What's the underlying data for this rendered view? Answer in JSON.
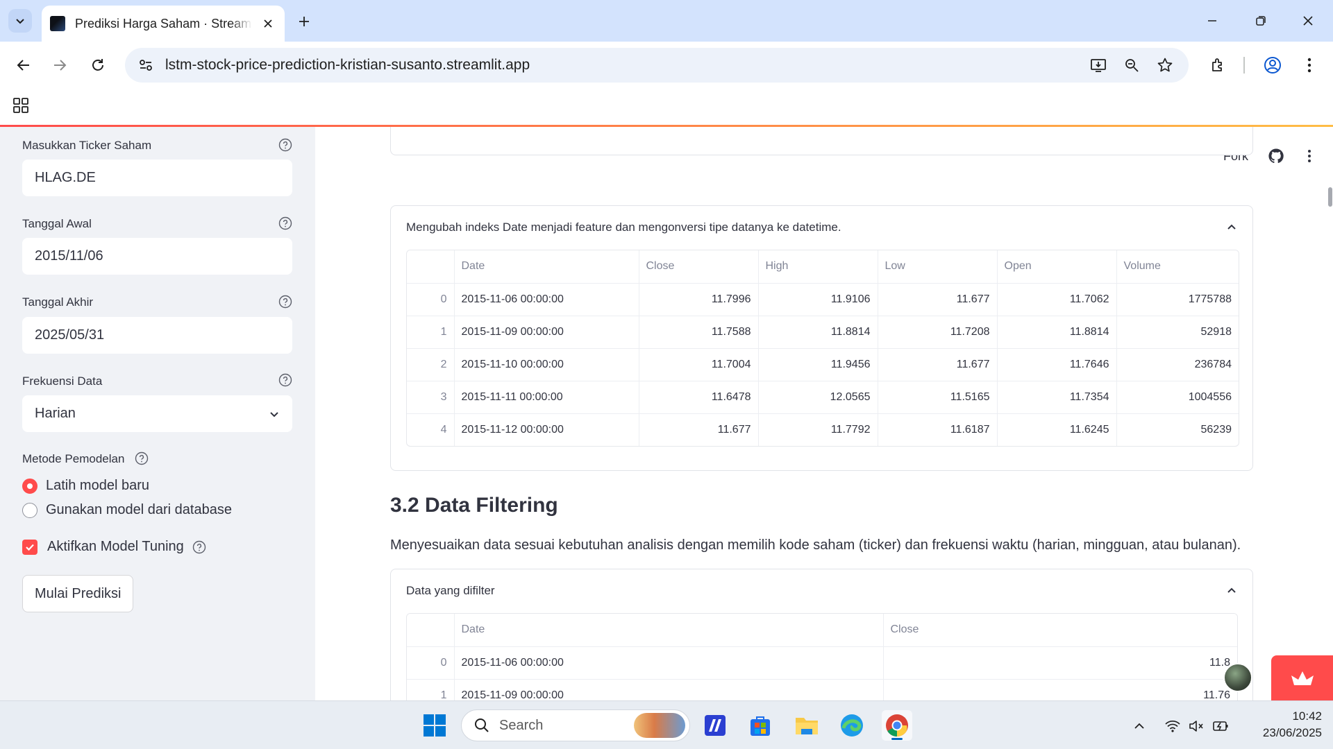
{
  "browser": {
    "tab_title": "Prediksi Harga Saham · Streamlit",
    "url": "lstm-stock-price-prediction-kristian-susanto.streamlit.app"
  },
  "sidebar": {
    "ticker_label": "Masukkan Ticker Saham",
    "ticker_value": "HLAG.DE",
    "start_label": "Tanggal Awal",
    "start_value": "2015/11/06",
    "end_label": "Tanggal Akhir",
    "end_value": "2025/05/31",
    "freq_label": "Frekuensi Data",
    "freq_value": "Harian",
    "method_label": "Metode Pemodelan",
    "method_options": [
      "Latih model baru",
      "Gunakan model dari database"
    ],
    "method_selected": 0,
    "tuning_label": "Aktifkan Model Tuning",
    "tuning_checked": true,
    "predict_button": "Mulai Prediksi"
  },
  "header": {
    "fork_label": "Fork"
  },
  "expander1": {
    "title": "Mengubah indeks Date menjadi feature dan mengonversi tipe datanya ke datetime.",
    "columns": [
      "",
      "Date",
      "Close",
      "High",
      "Low",
      "Open",
      "Volume"
    ],
    "rows": [
      [
        "0",
        "2015-11-06 00:00:00",
        "11.7996",
        "11.9106",
        "11.677",
        "11.7062",
        "1775788"
      ],
      [
        "1",
        "2015-11-09 00:00:00",
        "11.7588",
        "11.8814",
        "11.7208",
        "11.8814",
        "52918"
      ],
      [
        "2",
        "2015-11-10 00:00:00",
        "11.7004",
        "11.9456",
        "11.677",
        "11.7646",
        "236784"
      ],
      [
        "3",
        "2015-11-11 00:00:00",
        "11.6478",
        "12.0565",
        "11.5165",
        "11.7354",
        "1004556"
      ],
      [
        "4",
        "2015-11-12 00:00:00",
        "11.677",
        "11.7792",
        "11.6187",
        "11.6245",
        "56239"
      ]
    ]
  },
  "section": {
    "title": "3.2 Data Filtering",
    "description": "Menyesuaikan data sesuai kebutuhan analisis dengan memilih kode saham (ticker) dan frekuensi waktu (harian, mingguan, atau bulanan)."
  },
  "expander2": {
    "title": "Data yang difilter",
    "columns": [
      "",
      "Date",
      "Close"
    ],
    "rows": [
      [
        "0",
        "2015-11-06 00:00:00",
        "11.8"
      ],
      [
        "1",
        "2015-11-09 00:00:00",
        "11.76"
      ]
    ]
  },
  "taskbar": {
    "search_label": "Search",
    "time": "10:42",
    "date": "23/06/2025"
  },
  "colors": {
    "accent": "#ff4b4b",
    "sidebar_bg": "#f0f2f6",
    "text": "#31333f"
  }
}
